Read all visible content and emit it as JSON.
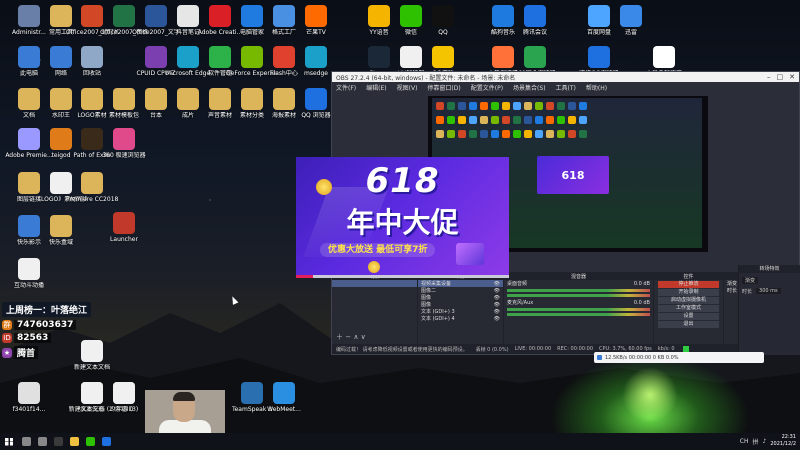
{
  "desktop_icons": [
    {
      "label": "Administr...",
      "color": "#6a7fa8",
      "icon": "user-folder-icon"
    },
    {
      "label": "常用工具",
      "color": "#dcb45a",
      "icon": "folder-icon"
    },
    {
      "label": "Office2007_幻灯片PPT",
      "color": "#d24726",
      "icon": "powerpoint-icon"
    },
    {
      "label": "Office2007_表格",
      "color": "#217346",
      "icon": "excel-icon"
    },
    {
      "label": "Office2007_文字",
      "color": "#2b579a",
      "icon": "word-icon"
    },
    {
      "label": "抖音笔记",
      "color": "#e6e6e6",
      "icon": "document-icon"
    },
    {
      "label": "Adobe Creati...",
      "color": "#da1f26",
      "icon": "adobe-cc-icon"
    },
    {
      "label": "电脑管家",
      "color": "#1f7be0",
      "icon": "shield-icon"
    },
    {
      "label": "格式工厂",
      "color": "#4a90e2",
      "icon": "format-factory-icon"
    },
    {
      "label": "芒果TV",
      "color": "#ff6a00",
      "icon": "mango-tv-icon"
    },
    {
      "label": "YY语音",
      "color": "#f5b400",
      "icon": "yy-icon"
    },
    {
      "label": "微信",
      "color": "#2dc100",
      "icon": "wechat-icon"
    },
    {
      "label": "QQ",
      "color": "#111111",
      "icon": "qq-icon"
    },
    {
      "label": "酷狗音乐",
      "color": "#1f7ae0",
      "icon": "kugou-icon"
    },
    {
      "label": "腾讯会议",
      "color": "#1e6fe0",
      "icon": "meeting-icon"
    },
    {
      "label": "百度网盘",
      "color": "#4da5ff",
      "icon": "baidu-pan-icon"
    },
    {
      "label": "迅雷",
      "color": "#3a88e8",
      "icon": "xunlei-icon"
    },
    {
      "label": "此电脑",
      "color": "#3a7bd5",
      "icon": "computer-icon"
    },
    {
      "label": "网络",
      "color": "#3a7bd5",
      "icon": "network-icon"
    },
    {
      "label": "回收站",
      "color": "#8fa8c8",
      "icon": "recycle-bin-icon"
    },
    {
      "label": "CPUID CPU-Z",
      "color": "#7b3fb0",
      "icon": "cpuz-icon"
    },
    {
      "label": "Microsoft Edge",
      "color": "#1ba0c9",
      "icon": "edge-icon"
    },
    {
      "label": "软件管理",
      "color": "#2db24a",
      "icon": "software-manager-icon"
    },
    {
      "label": "GeForce Experience",
      "color": "#76b900",
      "icon": "nvidia-icon"
    },
    {
      "label": "Flash中心",
      "color": "#e0412f",
      "icon": "flash-icon"
    },
    {
      "label": "msedge",
      "color": "#1ba0c9",
      "icon": "edge-icon"
    },
    {
      "label": "Steam",
      "color": "#1b2838",
      "icon": "steam-icon"
    },
    {
      "label": "UU加速器",
      "color": "#f0f0f0",
      "icon": "uu-icon"
    },
    {
      "label": "QQ游戏",
      "color": "#f5c400",
      "icon": "qq-game-icon"
    },
    {
      "label": "火狐浏览器",
      "color": "#ff7139",
      "icon": "firefox-icon"
    },
    {
      "label": "360安全浏览器",
      "color": "#2aa44f",
      "icon": "browser-icon"
    },
    {
      "label": "腾讯QQ浏览器",
      "color": "#1e6fe0",
      "icon": "qq-browser-icon"
    },
    {
      "label": "小黑盒加速器",
      "color": "#ffffff",
      "icon": "heybox-icon"
    },
    {
      "label": "文档",
      "color": "#dcb45a",
      "icon": "folder-icon"
    },
    {
      "label": "水印王",
      "color": "#dcb45a",
      "icon": "folder-icon"
    },
    {
      "label": "LOGO素材",
      "color": "#dcb45a",
      "icon": "folder-icon"
    },
    {
      "label": "素材模板包",
      "color": "#dcb45a",
      "icon": "folder-icon"
    },
    {
      "label": "台本",
      "color": "#dcb45a",
      "icon": "folder-icon"
    },
    {
      "label": "成片",
      "color": "#dcb45a",
      "icon": "folder-icon"
    },
    {
      "label": "声音素材",
      "color": "#dcb45a",
      "icon": "folder-icon"
    },
    {
      "label": "素材分类",
      "color": "#dcb45a",
      "icon": "folder-icon"
    },
    {
      "label": "海报素材",
      "color": "#dcb45a",
      "icon": "folder-icon"
    },
    {
      "label": "QQ 浏览器",
      "color": "#1e6fe0",
      "icon": "qq-browser-icon"
    },
    {
      "label": "Adobe Premie...",
      "color": "#9999ff",
      "icon": "premiere-icon"
    },
    {
      "label": "teigod",
      "color": "#e07b1a",
      "icon": "app-icon"
    },
    {
      "label": "Path of Exile",
      "color": "#3a2a1a",
      "icon": "poe-icon"
    },
    {
      "label": "360 极速浏览器",
      "color": "#e04a8a",
      "icon": "360-browser-icon"
    },
    {
      "label": "图层链接",
      "color": "#dcb45a",
      "icon": "folder-icon"
    },
    {
      "label": "《LOGO》素材同步",
      "color": "#f0f0f0",
      "icon": "document-icon"
    },
    {
      "label": "Premiere CC2018",
      "color": "#dcb45a",
      "icon": "folder-icon"
    },
    {
      "label": "Launcher",
      "color": "#c0392b",
      "icon": "launcher-icon"
    },
    {
      "label": "快乐影示",
      "color": "#3a7bd5",
      "icon": "app-icon"
    },
    {
      "label": "快乐盒域",
      "color": "#dcb45a",
      "icon": "folder-icon"
    },
    {
      "label": "互动斗动播",
      "color": "#f0f0f0",
      "icon": "document-icon"
    },
    {
      "label": "新建文本文档",
      "color": "#f0f0f0",
      "icon": "document-icon"
    },
    {
      "label": "水友先遣",
      "color": "#f0f0f0",
      "icon": "document-icon"
    },
    {
      "label": "游戏ID",
      "color": "#f0f0f0",
      "icon": "document-icon"
    },
    {
      "label": "f3401f14...",
      "color": "#e0e0e0",
      "icon": "image-icon"
    },
    {
      "label": "新建文本文档 (2)",
      "color": "#f0f0f0",
      "icon": "document-icon"
    },
    {
      "label": "少年游 (3)",
      "color": "#f0f0f0",
      "icon": "document-icon"
    },
    {
      "label": "TeamSpeak 3",
      "color": "#2a6fb0",
      "icon": "teamspeak-icon"
    },
    {
      "label": "WebMeet...",
      "color": "#2a8fe0",
      "icon": "webmeet-icon"
    }
  ],
  "obs": {
    "title": "OBS 27.2.4 (64-bit, windows) - 配置文件: 未命名 - 场景: 未命名",
    "menu": [
      "文件(F)",
      "编辑(E)",
      "视图(V)",
      "停靠窗口(D)",
      "配置文件(P)",
      "场景集合(S)",
      "工具(T)",
      "帮助(H)"
    ],
    "docks": {
      "scenes_title": "场景",
      "sources_title": "来源",
      "sources": [
        "视频采集设备",
        "图像二",
        "图像",
        "图像",
        "文本 (GDI+) 3",
        "文本 (GDI+) 4"
      ],
      "mixer_title": "混音器",
      "mixer_channels": [
        {
          "name": "桌面音频",
          "level": "0.0 dB"
        },
        {
          "name": "麦克风/Aux",
          "level": "0.0 dB"
        }
      ],
      "transitions_title": "转场特效",
      "transition_mode": "渐变",
      "duration_label": "时长",
      "duration_value": "300 ms",
      "controls_title": "控件",
      "controls": [
        "停止推流",
        "开始录制",
        "启动虚拟摄像机",
        "工作室模式",
        "设置",
        "退出"
      ]
    },
    "status_hint": "编码过载！ 请考虑降低视频设置或者使用更快的编码预设。",
    "status_items": [
      "丢帧 0 (0.0%)",
      "LIVE: 00:00:00",
      "REC: 00:00:00",
      "CPU: 3.7%, 60.00 fps",
      "kb/s: 0"
    ]
  },
  "banner": {
    "number": "618",
    "title": "年中大促",
    "subtitle": "优惠大放送  最低可享7折",
    "progress": 0.08,
    "colors": {
      "bg": "#4b2bd8",
      "accent": "#ffe34a",
      "progress": "#e21f5c"
    }
  },
  "stream_overlay": {
    "headline": "上周榜一：叶落绝江",
    "lines": [
      "747603637",
      "82563",
      "腾首"
    ]
  },
  "speed_bar": {
    "text": "12.5KB/s  00:00:00  0 KB  0.0%"
  },
  "taskbar": {
    "apps": [
      {
        "name": "search",
        "color": "#888888"
      },
      {
        "name": "task-view",
        "color": "#888888"
      },
      {
        "name": "obs",
        "color": "#3a3a3a"
      },
      {
        "name": "file-explorer",
        "color": "#f0c040"
      },
      {
        "name": "wechat",
        "color": "#2dc100"
      },
      {
        "name": "qq",
        "color": "#1e6fe0"
      }
    ],
    "tray": [
      "CH",
      "拼"
    ],
    "time": "22:31",
    "date": "2021/12/2"
  }
}
